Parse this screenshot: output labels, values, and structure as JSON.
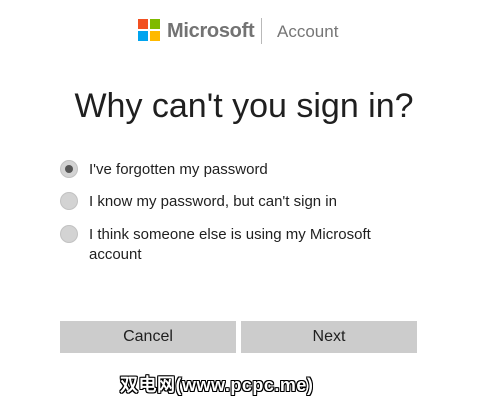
{
  "header": {
    "brand": "Microsoft",
    "product": "Account",
    "logo_colors": [
      "#f25022",
      "#7fba00",
      "#00a4ef",
      "#ffb900"
    ]
  },
  "title": "Why can't you sign in?",
  "options": [
    {
      "label": "I've forgotten my password",
      "selected": true
    },
    {
      "label": "I know my password, but can't sign in",
      "selected": false
    },
    {
      "label": "I think someone else is using my Microsoft account",
      "selected": false
    }
  ],
  "buttons": {
    "cancel": "Cancel",
    "next": "Next"
  },
  "watermark": "双电网(www.pcpc.me)"
}
